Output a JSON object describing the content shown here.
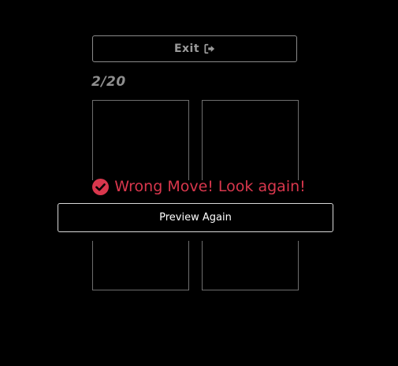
{
  "header": {
    "exit_label": "Exit",
    "exit_icon": "sign-out-icon"
  },
  "progress": {
    "text": "2/20",
    "current": 2,
    "total": 20
  },
  "feedback": {
    "message": "Wrong Move! Look again!",
    "icon": "check-circle-icon",
    "color": "#d9374d"
  },
  "actions": {
    "preview_label": "Preview Again"
  },
  "tiles": [
    "",
    "",
    "",
    ""
  ]
}
